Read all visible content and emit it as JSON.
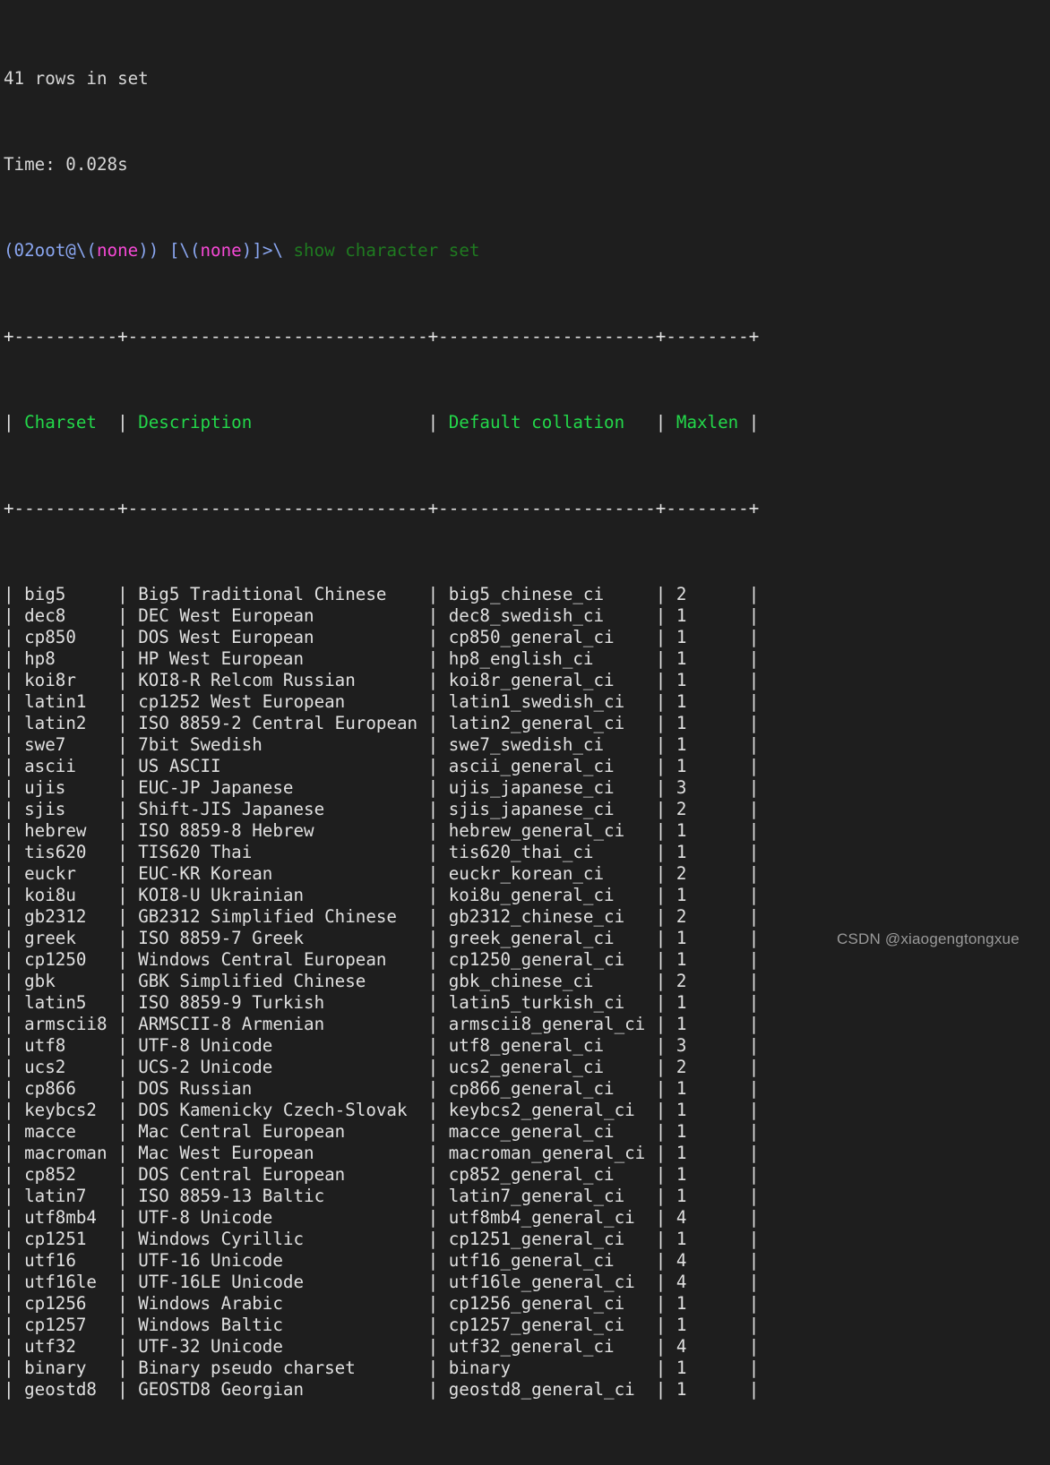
{
  "terminal": {
    "background": "#1e1e1e",
    "result_status": "41 rows in set",
    "timing": "Time: 0.028s",
    "prompt": {
      "part1": "(02oot@\\(",
      "db1": "none",
      "part2": ")) [\\(",
      "db2": "none",
      "part3": ")]>\\ ",
      "command": "show character set"
    },
    "colors": {
      "header_green": "#23d84a",
      "command_green": "#1f7a20",
      "magenta": "#f649d6",
      "blue": "#8aa6f0",
      "border": "#e3e3e3",
      "cell_text": "#e0e0e0"
    },
    "table": {
      "border_top": "+----------+-----------------------------+---------------------+--------+",
      "border_mid": "+----------+-----------------------------+---------------------+--------+",
      "columns": [
        {
          "label": "Charset",
          "width": 9
        },
        {
          "label": "Description",
          "width": 28
        },
        {
          "label": "Default collation",
          "width": 20
        },
        {
          "label": "Maxlen",
          "width": 7
        }
      ],
      "rows": [
        {
          "charset": "big5",
          "description": "Big5 Traditional Chinese",
          "collation": "big5_chinese_ci",
          "maxlen": "2"
        },
        {
          "charset": "dec8",
          "description": "DEC West European",
          "collation": "dec8_swedish_ci",
          "maxlen": "1"
        },
        {
          "charset": "cp850",
          "description": "DOS West European",
          "collation": "cp850_general_ci",
          "maxlen": "1"
        },
        {
          "charset": "hp8",
          "description": "HP West European",
          "collation": "hp8_english_ci",
          "maxlen": "1"
        },
        {
          "charset": "koi8r",
          "description": "KOI8-R Relcom Russian",
          "collation": "koi8r_general_ci",
          "maxlen": "1"
        },
        {
          "charset": "latin1",
          "description": "cp1252 West European",
          "collation": "latin1_swedish_ci",
          "maxlen": "1"
        },
        {
          "charset": "latin2",
          "description": "ISO 8859-2 Central European",
          "collation": "latin2_general_ci",
          "maxlen": "1"
        },
        {
          "charset": "swe7",
          "description": "7bit Swedish",
          "collation": "swe7_swedish_ci",
          "maxlen": "1"
        },
        {
          "charset": "ascii",
          "description": "US ASCII",
          "collation": "ascii_general_ci",
          "maxlen": "1"
        },
        {
          "charset": "ujis",
          "description": "EUC-JP Japanese",
          "collation": "ujis_japanese_ci",
          "maxlen": "3"
        },
        {
          "charset": "sjis",
          "description": "Shift-JIS Japanese",
          "collation": "sjis_japanese_ci",
          "maxlen": "2"
        },
        {
          "charset": "hebrew",
          "description": "ISO 8859-8 Hebrew",
          "collation": "hebrew_general_ci",
          "maxlen": "1"
        },
        {
          "charset": "tis620",
          "description": "TIS620 Thai",
          "collation": "tis620_thai_ci",
          "maxlen": "1"
        },
        {
          "charset": "euckr",
          "description": "EUC-KR Korean",
          "collation": "euckr_korean_ci",
          "maxlen": "2"
        },
        {
          "charset": "koi8u",
          "description": "KOI8-U Ukrainian",
          "collation": "koi8u_general_ci",
          "maxlen": "1"
        },
        {
          "charset": "gb2312",
          "description": "GB2312 Simplified Chinese",
          "collation": "gb2312_chinese_ci",
          "maxlen": "2"
        },
        {
          "charset": "greek",
          "description": "ISO 8859-7 Greek",
          "collation": "greek_general_ci",
          "maxlen": "1"
        },
        {
          "charset": "cp1250",
          "description": "Windows Central European",
          "collation": "cp1250_general_ci",
          "maxlen": "1"
        },
        {
          "charset": "gbk",
          "description": "GBK Simplified Chinese",
          "collation": "gbk_chinese_ci",
          "maxlen": "2"
        },
        {
          "charset": "latin5",
          "description": "ISO 8859-9 Turkish",
          "collation": "latin5_turkish_ci",
          "maxlen": "1"
        },
        {
          "charset": "armscii8",
          "description": "ARMSCII-8 Armenian",
          "collation": "armscii8_general_ci",
          "maxlen": "1"
        },
        {
          "charset": "utf8",
          "description": "UTF-8 Unicode",
          "collation": "utf8_general_ci",
          "maxlen": "3"
        },
        {
          "charset": "ucs2",
          "description": "UCS-2 Unicode",
          "collation": "ucs2_general_ci",
          "maxlen": "2"
        },
        {
          "charset": "cp866",
          "description": "DOS Russian",
          "collation": "cp866_general_ci",
          "maxlen": "1"
        },
        {
          "charset": "keybcs2",
          "description": "DOS Kamenicky Czech-Slovak",
          "collation": "keybcs2_general_ci",
          "maxlen": "1"
        },
        {
          "charset": "macce",
          "description": "Mac Central European",
          "collation": "macce_general_ci",
          "maxlen": "1"
        },
        {
          "charset": "macroman",
          "description": "Mac West European",
          "collation": "macroman_general_ci",
          "maxlen": "1"
        },
        {
          "charset": "cp852",
          "description": "DOS Central European",
          "collation": "cp852_general_ci",
          "maxlen": "1"
        },
        {
          "charset": "latin7",
          "description": "ISO 8859-13 Baltic",
          "collation": "latin7_general_ci",
          "maxlen": "1"
        },
        {
          "charset": "utf8mb4",
          "description": "UTF-8 Unicode",
          "collation": "utf8mb4_general_ci",
          "maxlen": "4"
        },
        {
          "charset": "cp1251",
          "description": "Windows Cyrillic",
          "collation": "cp1251_general_ci",
          "maxlen": "1"
        },
        {
          "charset": "utf16",
          "description": "UTF-16 Unicode",
          "collation": "utf16_general_ci",
          "maxlen": "4"
        },
        {
          "charset": "utf16le",
          "description": "UTF-16LE Unicode",
          "collation": "utf16le_general_ci",
          "maxlen": "4"
        },
        {
          "charset": "cp1256",
          "description": "Windows Arabic",
          "collation": "cp1256_general_ci",
          "maxlen": "1"
        },
        {
          "charset": "cp1257",
          "description": "Windows Baltic",
          "collation": "cp1257_general_ci",
          "maxlen": "1"
        },
        {
          "charset": "utf32",
          "description": "UTF-32 Unicode",
          "collation": "utf32_general_ci",
          "maxlen": "4"
        },
        {
          "charset": "binary",
          "description": "Binary pseudo charset",
          "collation": "binary",
          "maxlen": "1"
        },
        {
          "charset": "geostd8",
          "description": "GEOSTD8 Georgian",
          "collation": "geostd8_general_ci",
          "maxlen": "1"
        }
      ]
    },
    "watermark": "CSDN @xiaogengtongxue"
  }
}
